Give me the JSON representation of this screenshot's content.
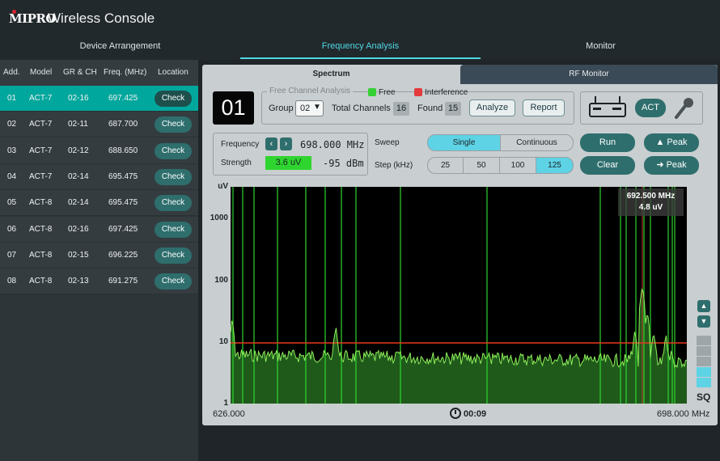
{
  "app": {
    "brand": "MIPRO",
    "title": "Wireless Console"
  },
  "nav": {
    "tabs": [
      {
        "label": "Device Arrangement"
      },
      {
        "label": "Frequency Analysis"
      },
      {
        "label": "Monitor"
      }
    ],
    "active": 1
  },
  "device_list": {
    "headers": [
      "Add.",
      "Model",
      "GR & CH",
      "Freq. (MHz)",
      "Location"
    ],
    "check_label": "Check",
    "selected": 0,
    "rows": [
      {
        "addr": "01",
        "model": "ACT-7",
        "grch": "02-16",
        "freq": "697.425"
      },
      {
        "addr": "02",
        "model": "ACT-7",
        "grch": "02-11",
        "freq": "687.700"
      },
      {
        "addr": "03",
        "model": "ACT-7",
        "grch": "02-12",
        "freq": "688.650"
      },
      {
        "addr": "04",
        "model": "ACT-7",
        "grch": "02-14",
        "freq": "695.475"
      },
      {
        "addr": "05",
        "model": "ACT-8",
        "grch": "02-14",
        "freq": "695.475"
      },
      {
        "addr": "06",
        "model": "ACT-8",
        "grch": "02-16",
        "freq": "697.425"
      },
      {
        "addr": "07",
        "model": "ACT-8",
        "grch": "02-15",
        "freq": "696.225"
      },
      {
        "addr": "08",
        "model": "ACT-8",
        "grch": "02-13",
        "freq": "691.275"
      }
    ]
  },
  "subtabs": {
    "spectrum": "Spectrum",
    "rf_monitor": "RF Monitor"
  },
  "channel": "01",
  "fca": {
    "title": "Free Channel Analysis",
    "free_label": "Free",
    "interference_label": "Interference",
    "group_label": "Group",
    "group_value": "02",
    "total_label": "Total Channels",
    "total_value": "16",
    "found_label": "Found",
    "found_value": "15",
    "analyze": "Analyze",
    "report": "Report"
  },
  "device": {
    "act_label": "ACT"
  },
  "readout": {
    "frequency_label": "Frequency",
    "frequency_value": "698.000 MHz",
    "strength_label": "Strength",
    "strength_uv": "3.6 uV",
    "strength_dbm": "-95 dBm"
  },
  "sweep": {
    "label": "Sweep",
    "options": [
      "Single",
      "Continuous"
    ],
    "selected": "Single"
  },
  "step": {
    "label": "Step (kHz)",
    "options": [
      "25",
      "50",
      "100",
      "125"
    ],
    "selected": "125"
  },
  "actions": {
    "run": "Run",
    "clear": "Clear",
    "peak_up": "▲ Peak",
    "peak_right": "➜ Peak"
  },
  "spectrum": {
    "y_unit": "uV",
    "y_ticks": [
      "1000",
      "100",
      "10",
      "1"
    ],
    "x_start": "626.000",
    "x_end": "698.000 MHz",
    "timer": "00:09",
    "tooltip_freq": "692.500 MHz",
    "tooltip_level": "4.8 uV",
    "sq_label": "SQ",
    "colors": {
      "trace": "#8df05a",
      "fill": "#1f5a1b",
      "markers": "#2fd52f",
      "threshold": "#e8391c",
      "cursor": "#c43a2c"
    }
  }
}
